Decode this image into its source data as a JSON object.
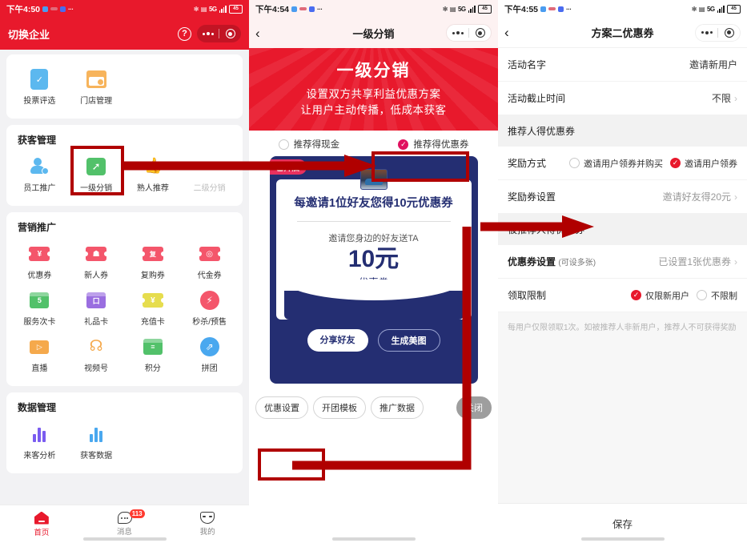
{
  "panel1": {
    "status": {
      "time": "下午4:50",
      "battery": "45",
      "network": "5G"
    },
    "nav": {
      "title": "切换企业",
      "help_icon": "question-mark-icon",
      "more_icon": "more-dots-icon",
      "capsule_icon": "target-icon"
    },
    "sections": [
      {
        "title": "",
        "items": [
          {
            "label": "投票评选",
            "icon": "clipboard-check-icon",
            "color": "#5cb8ef",
            "shape": "rect",
            "glyph": "✓",
            "disabled": false
          },
          {
            "label": "门店管理",
            "icon": "shop-icon",
            "color": "#f7b45c",
            "shape": "shop",
            "glyph": "",
            "disabled": false
          }
        ]
      },
      {
        "title": "获客管理",
        "items": [
          {
            "label": "员工推广",
            "icon": "user-plus-icon",
            "color": "#5cb8ef",
            "shape": "person",
            "glyph": "",
            "disabled": false
          },
          {
            "label": "一级分销",
            "icon": "share-arrow-icon",
            "color": "#52c16a",
            "shape": "share",
            "glyph": "",
            "disabled": false
          },
          {
            "label": "熟人推荐",
            "icon": "thumbs-up-icon",
            "color": "#f4738a",
            "shape": "thumb",
            "glyph": "",
            "disabled": false
          },
          {
            "label": "二级分销",
            "icon": "network-share-icon",
            "color": "#e2e2e2",
            "shape": "network",
            "glyph": "",
            "disabled": true
          }
        ]
      },
      {
        "title": "营销推广",
        "items": [
          {
            "label": "优惠券",
            "icon": "coupon-yuan-icon",
            "color": "#f4566b",
            "shape": "ticket",
            "glyph": "¥",
            "disabled": false
          },
          {
            "label": "新人券",
            "icon": "coupon-person-icon",
            "color": "#f4566b",
            "shape": "ticket",
            "glyph": "☗",
            "disabled": false
          },
          {
            "label": "复购券",
            "icon": "coupon-repeat-icon",
            "color": "#f4566b",
            "shape": "ticket",
            "glyph": "复",
            "disabled": false
          },
          {
            "label": "代金券",
            "icon": "coupon-voucher-icon",
            "color": "#f4566b",
            "shape": "ticket",
            "glyph": "◎",
            "disabled": false
          },
          {
            "label": "服务次卡",
            "icon": "service-card-icon",
            "color": "#52c16a",
            "shape": "box",
            "glyph": "5",
            "disabled": false
          },
          {
            "label": "礼品卡",
            "icon": "gift-card-icon",
            "color": "#9a6ee0",
            "shape": "box",
            "glyph": "口",
            "disabled": false
          },
          {
            "label": "充值卡",
            "icon": "recharge-card-icon",
            "color": "#e6dd4e",
            "shape": "ticket",
            "glyph": "¥",
            "disabled": false
          },
          {
            "label": "秒杀/预售",
            "icon": "alarm-flash-icon",
            "color": "#f4566b",
            "shape": "circle",
            "glyph": "⚡",
            "disabled": false
          },
          {
            "label": "直播",
            "icon": "video-camera-icon",
            "color": "#f5a94c",
            "shape": "video",
            "glyph": "",
            "disabled": false
          },
          {
            "label": "视频号",
            "icon": "channels-icon",
            "color": "#f5a94c",
            "shape": "channels",
            "glyph": "",
            "disabled": false
          },
          {
            "label": "积分",
            "icon": "points-coins-icon",
            "color": "#52c16a",
            "shape": "box",
            "glyph": "≡",
            "disabled": false
          },
          {
            "label": "拼团",
            "icon": "group-buy-icon",
            "color": "#4aa8ef",
            "shape": "circle",
            "glyph": "⇗",
            "disabled": false
          }
        ]
      },
      {
        "title": "数据管理",
        "items": [
          {
            "label": "来客分析",
            "icon": "bar-chart-icon",
            "color": "#7a5cf0",
            "shape": "bars",
            "glyph": "",
            "disabled": false
          },
          {
            "label": "获客数据",
            "icon": "bar-chart-blue-icon",
            "color": "#4aa8ef",
            "shape": "bars",
            "glyph": "",
            "disabled": false
          }
        ]
      }
    ],
    "tabbar": [
      {
        "label": "首页",
        "icon": "home-icon",
        "active": true,
        "badge": ""
      },
      {
        "label": "消息",
        "icon": "message-icon",
        "active": false,
        "badge": "113"
      },
      {
        "label": "我的",
        "icon": "profile-icon",
        "active": false,
        "badge": ""
      }
    ]
  },
  "panel2": {
    "status": {
      "time": "下午4:54",
      "battery": "45",
      "network": "5G"
    },
    "nav": {
      "back_icon": "back-chevron-icon",
      "title": "一级分销",
      "more_icon": "more-dots-icon",
      "capsule_icon": "target-icon"
    },
    "banner": {
      "title": "一级分销",
      "line1": "设置双方共享利益优惠方案",
      "line2": "让用户主动传播，低成本获客"
    },
    "radio_options": [
      {
        "label": "推荐得现金",
        "selected": false
      },
      {
        "label": "推荐得优惠券",
        "selected": true
      }
    ],
    "poster": {
      "badge": "已开启",
      "headline": "每邀请1位好友您得10元优惠券",
      "subtitle": "邀请您身边的好友送TA",
      "amount": "10元",
      "coupon_label": "优惠券",
      "buttons": [
        {
          "label": "分享好友",
          "style": "solid"
        },
        {
          "label": "生成美图",
          "style": "outline"
        }
      ]
    },
    "foot_buttons": [
      {
        "label": "优惠设置",
        "style": "outline"
      },
      {
        "label": "开团模板",
        "style": "outline"
      },
      {
        "label": "推广数据",
        "style": "outline"
      },
      {
        "label": "关闭",
        "style": "grey"
      }
    ]
  },
  "panel3": {
    "status": {
      "time": "下午4:55",
      "battery": "45",
      "network": "5G"
    },
    "nav": {
      "back_icon": "back-chevron-icon",
      "title": "方案二优惠券",
      "more_icon": "more-dots-icon",
      "capsule_icon": "target-icon"
    },
    "rows": [
      {
        "kind": "row",
        "label": "活动名字",
        "sublabel": "",
        "value": "邀请新用户",
        "chevron": false,
        "dim": false
      },
      {
        "kind": "row",
        "label": "活动截止时间",
        "sublabel": "",
        "value": "不限",
        "chevron": true,
        "dim": false
      },
      {
        "kind": "section",
        "label": "推荐人得优惠券"
      },
      {
        "kind": "options",
        "label": "奖励方式",
        "options": [
          {
            "label": "邀请用户领券并购买",
            "selected": false
          },
          {
            "label": "邀请用户领券",
            "selected": true
          }
        ]
      },
      {
        "kind": "row",
        "label": "奖励券设置",
        "sublabel": "",
        "value": "邀请好友得20元",
        "chevron": true,
        "dim": true
      },
      {
        "kind": "section",
        "label": "被推荐人得优惠券"
      },
      {
        "kind": "row",
        "label": "优惠券设置",
        "sublabel": "(可设多张)",
        "value": "已设置1张优惠券",
        "chevron": true,
        "dim": true
      },
      {
        "kind": "options",
        "label": "领取限制",
        "options": [
          {
            "label": "仅限新用户",
            "selected": true
          },
          {
            "label": "不限制",
            "selected": false
          }
        ]
      }
    ],
    "hint": "每用户仅限领取1次。如被推荐人非新用户，推荐人不可获得奖励",
    "save_label": "保存"
  },
  "annotations": {
    "accent_red": "#b00000",
    "boxes": [
      "一级分销",
      "推荐得优惠券",
      "优惠设置"
    ]
  }
}
